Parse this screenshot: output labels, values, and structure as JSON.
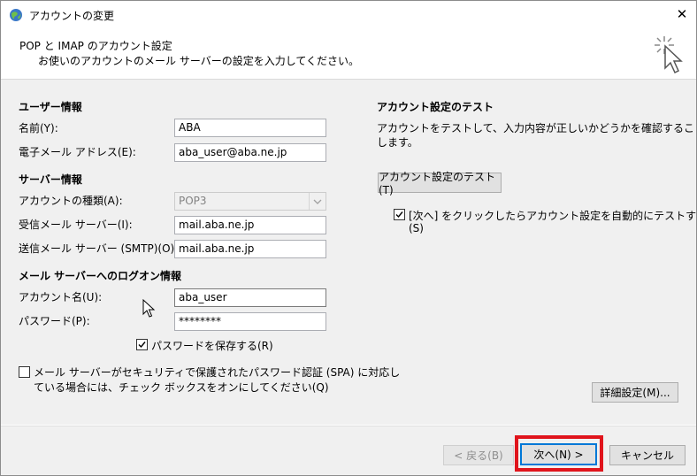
{
  "window": {
    "title": "アカウントの変更",
    "close_glyph": "✕"
  },
  "header": {
    "title": "POP と IMAP のアカウント設定",
    "subtitle": "お使いのアカウントのメール サーバーの設定を入力してください。"
  },
  "user_info": {
    "heading": "ユーザー情報",
    "name_label": "名前(Y):",
    "name_value": "ABA",
    "email_label": "電子メール アドレス(E):",
    "email_value": "aba_user@aba.ne.jp"
  },
  "server_info": {
    "heading": "サーバー情報",
    "account_type_label": "アカウントの種類(A):",
    "account_type_value": "POP3",
    "incoming_label": "受信メール サーバー(I):",
    "incoming_value": "mail.aba.ne.jp",
    "outgoing_label": "送信メール サーバー (SMTP)(O):",
    "outgoing_value": "mail.aba.ne.jp"
  },
  "logon_info": {
    "heading": "メール サーバーへのログオン情報",
    "account_name_label": "アカウント名(U):",
    "account_name_value": "aba_user",
    "password_label": "パスワード(P):",
    "password_value": "********",
    "remember_password_label": "パスワードを保存する(R)",
    "remember_password_checked": true
  },
  "spa": {
    "label_line1": "メール サーバーがセキュリティで保護されたパスワード認証 (SPA) に対応し",
    "label_line2": "ている場合には、チェック ボックスをオンにしてください(Q)",
    "checked": false
  },
  "test_section": {
    "heading": "アカウント設定のテスト",
    "description_line1": "アカウントをテストして、入力内容が正しいかどうかを確認することをお勧め",
    "description_line2": "します。",
    "test_button": "アカウント設定のテスト(T)",
    "auto_test_line1": "[次へ] をクリックしたらアカウント設定を自動的にテストする",
    "auto_test_line2": "(S)",
    "auto_test_checked": true
  },
  "buttons": {
    "details": "詳細設定(M)...",
    "back": "< 戻る(B)",
    "next": "次へ(N) >",
    "cancel": "キャンセル"
  },
  "colors": {
    "accent": "#0078d7",
    "highlight": "#e0141c",
    "dialog_bg": "#f0f0f0"
  }
}
